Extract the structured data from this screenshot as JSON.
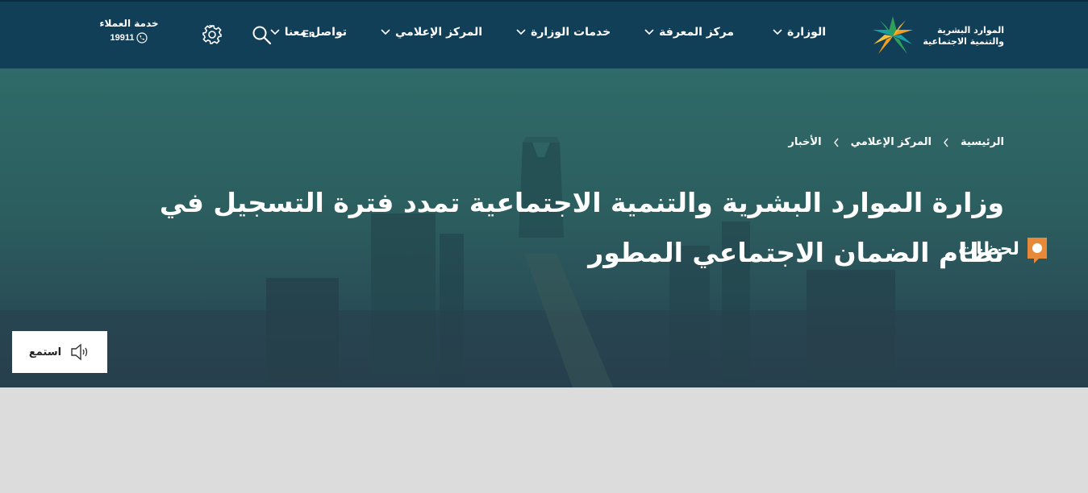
{
  "header": {
    "logo_line1": "الموارد البشرية",
    "logo_line2": "والتنمية الاجتماعية",
    "nav": [
      {
        "label": "الوزارة"
      },
      {
        "label": "مركز المعرفة"
      },
      {
        "label": "خدمات الوزارة"
      },
      {
        "label": "المركز الإعلامي"
      },
      {
        "label": "تواصل معنا"
      }
    ],
    "lang_label": "En",
    "customer_service_label": "خدمة العملاء",
    "customer_service_number": "19911"
  },
  "breadcrumb": [
    "الرئيسية",
    "المركز الإعلامي",
    "الأخبار"
  ],
  "article": {
    "title": "وزارة الموارد البشرية والتنمية الاجتماعية تمدد فترة التسجيل في نظام الضمان الاجتماعي المطور"
  },
  "watermark": {
    "text": "لحظات"
  },
  "listen_button": {
    "label": "استمع"
  },
  "colors": {
    "header_bg": "#123f58",
    "hero_overlay": "#2a5a5c",
    "logo_green": "#2e9e5b",
    "logo_orange": "#f29b1d",
    "logo_teal": "#18a0a4"
  }
}
